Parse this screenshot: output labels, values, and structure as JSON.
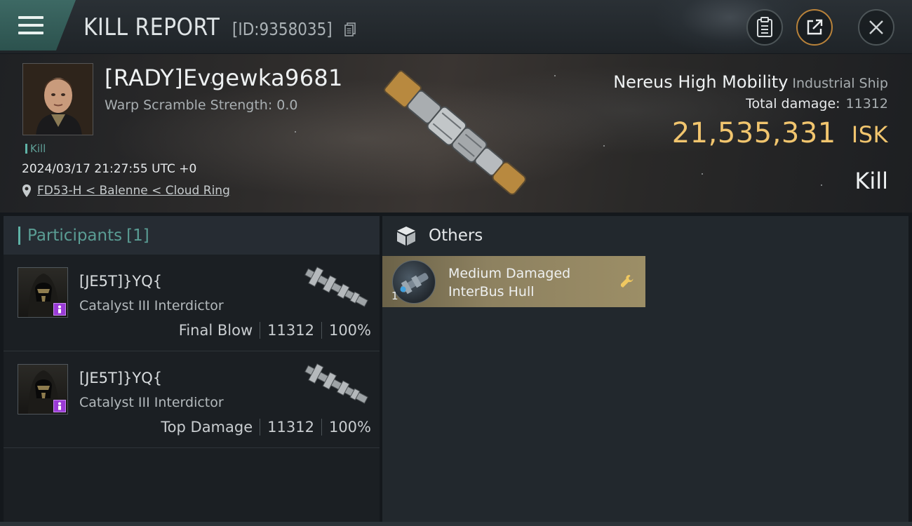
{
  "header": {
    "title": "KILL REPORT",
    "report_id": "[ID:9358035]"
  },
  "victim": {
    "pilot_name": "[RADY]Evgewka9681",
    "warp_scramble": "Warp Scramble Strength: 0.0",
    "kill_tag": "Kill",
    "datetime": "2024/03/17 21:27:55 UTC +0",
    "location": "FD53-H < Balenne < Cloud Ring",
    "ship_name": "Nereus High Mobility",
    "ship_class": "Industrial Ship",
    "total_damage_label": "Total damage:",
    "total_damage_value": "11312",
    "isk_value": "21,535,331",
    "isk_unit": "ISK",
    "result": "Kill"
  },
  "participants": {
    "label": "Participants",
    "count": "[1]",
    "rows": [
      {
        "name": "[JE5T]}YQ{",
        "ship": "Catalyst III Interdictor",
        "stat_label": "Final Blow",
        "damage": "11312",
        "percent": "100%"
      },
      {
        "name": "[JE5T]}YQ{",
        "ship": "Catalyst III Interdictor",
        "stat_label": "Top Damage",
        "damage": "11312",
        "percent": "100%"
      }
    ]
  },
  "others": {
    "label": "Others",
    "items": [
      {
        "name": "Medium Damaged InterBus Hull",
        "qty": "1"
      }
    ]
  },
  "colors": {
    "accent_teal": "#5fb3a7",
    "isk_gold": "#f1c56e",
    "item_card": "#8d8160",
    "badge_purple": "#9a3ad6"
  },
  "icons": [
    "menu-icon",
    "copy-icon",
    "clipboard-icon",
    "share-icon",
    "close-icon",
    "location-pin-icon",
    "cube-icon",
    "wrench-icon"
  ]
}
